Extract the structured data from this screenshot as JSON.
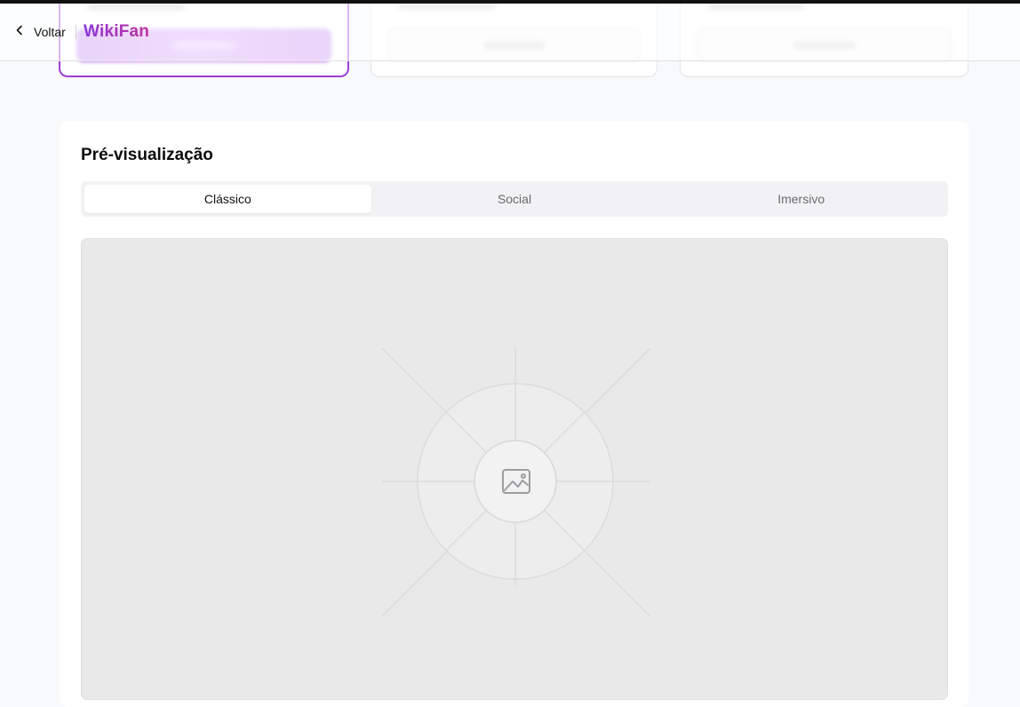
{
  "header": {
    "back_label": "Voltar",
    "brand": "WikiFan"
  },
  "preview": {
    "title": "Pré-visualização",
    "tabs": [
      {
        "label": "Clássico",
        "active": true
      },
      {
        "label": "Social",
        "active": false
      },
      {
        "label": "Imersivo",
        "active": false
      }
    ],
    "placeholder_icon": "image-icon"
  },
  "colors": {
    "brand_start": "#8b35d8",
    "brand_end": "#c0339a",
    "selected_border": "#9b3fd6"
  }
}
